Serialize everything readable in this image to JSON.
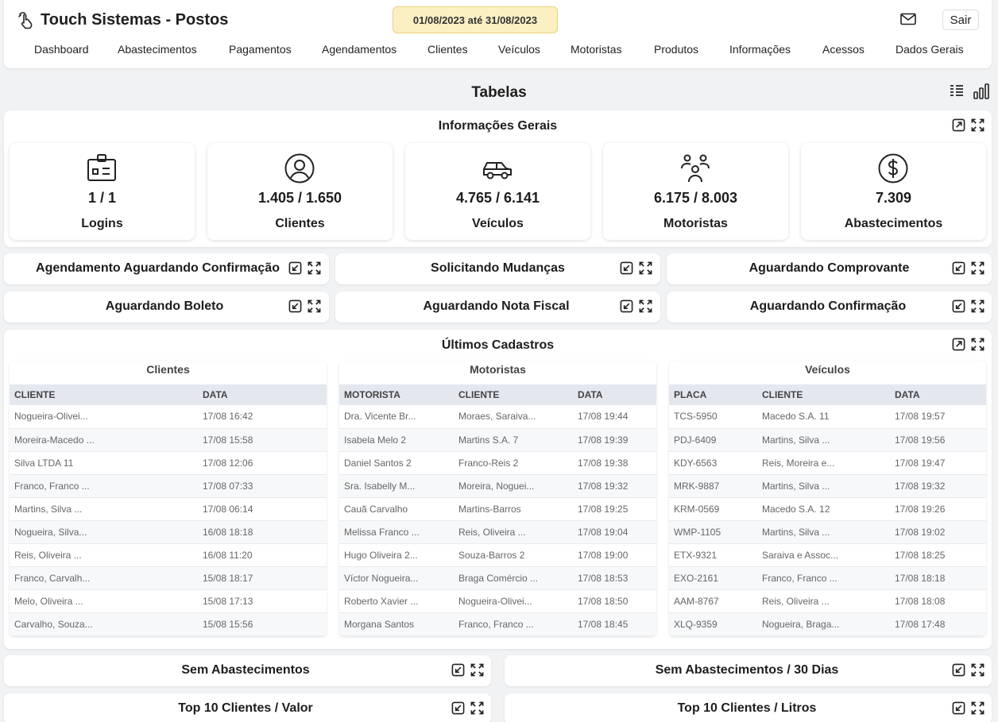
{
  "app": {
    "title": "Touch Sistemas - Postos"
  },
  "header": {
    "date_range": "01/08/2023 até 31/08/2023",
    "logout_label": "Sair",
    "nav": [
      "Dashboard",
      "Abastecimentos",
      "Pagamentos",
      "Agendamentos",
      "Clientes",
      "Veículos",
      "Motoristas",
      "Produtos",
      "Informações",
      "Acessos",
      "Dados Gerais"
    ]
  },
  "section": {
    "title": "Tabelas"
  },
  "info": {
    "title": "Informações Gerais",
    "stats": [
      {
        "icon": "id-card-icon",
        "value": "1 / 1",
        "label": "Logins"
      },
      {
        "icon": "user-circle-icon",
        "value": "1.405 / 1.650",
        "label": "Clientes"
      },
      {
        "icon": "car-icon",
        "value": "4.765 / 6.141",
        "label": "Veículos"
      },
      {
        "icon": "users-icon",
        "value": "6.175 / 8.003",
        "label": "Motoristas"
      },
      {
        "icon": "dollar-icon",
        "value": "7.309",
        "label": "Abastecimentos"
      }
    ]
  },
  "panels": {
    "agendamento": "Agendamento Aguardando Confirmação",
    "mudancas": "Solicitando Mudanças",
    "comprovante": "Aguardando Comprovante",
    "boleto": "Aguardando Boleto",
    "nota_fiscal": "Aguardando Nota Fiscal",
    "confirmacao": "Aguardando Confirmação",
    "sem_abast": "Sem Abastecimentos",
    "sem_abast_30": "Sem Abastecimentos / 30 Dias",
    "top_valor": "Top 10 Clientes / Valor",
    "top_litros": "Top 10 Clientes / Litros"
  },
  "ultimos": {
    "title": "Últimos Cadastros",
    "clientes": {
      "title": "Clientes",
      "headers": [
        "CLIENTE",
        "DATA"
      ],
      "rows": [
        [
          "Nogueira-Olivei...",
          "17/08 16:42"
        ],
        [
          "Moreira-Macedo ...",
          "17/08 15:58"
        ],
        [
          "Silva LTDA 11",
          "17/08 12:06"
        ],
        [
          "Franco, Franco ...",
          "17/08 07:33"
        ],
        [
          "Martins, Silva ...",
          "17/08 06:14"
        ],
        [
          "Nogueira, Silva...",
          "16/08 18:18"
        ],
        [
          "Reis, Oliveira ...",
          "16/08 11:20"
        ],
        [
          "Franco, Carvalh...",
          "15/08 18:17"
        ],
        [
          "Melo, Oliveira ...",
          "15/08 17:13"
        ],
        [
          "Carvalho, Souza...",
          "15/08 15:56"
        ]
      ]
    },
    "motoristas": {
      "title": "Motoristas",
      "headers": [
        "MOTORISTA",
        "CLIENTE",
        "DATA"
      ],
      "rows": [
        [
          "Dra. Vicente Br...",
          "Moraes, Saraiva...",
          "17/08 19:44"
        ],
        [
          "Isabela Melo 2",
          "Martins S.A. 7",
          "17/08 19:39"
        ],
        [
          "Daniel Santos 2",
          "Franco-Reis 2",
          "17/08 19:38"
        ],
        [
          "Sra. Isabelly M...",
          "Moreira, Noguei...",
          "17/08 19:32"
        ],
        [
          "Cauã Carvalho",
          "Martins-Barros",
          "17/08 19:25"
        ],
        [
          "Melissa Franco ...",
          "Reis, Oliveira ...",
          "17/08 19:04"
        ],
        [
          "Hugo Oliveira 2...",
          "Souza-Barros 2",
          "17/08 19:00"
        ],
        [
          "Víctor Nogueira...",
          "Braga Comércio ...",
          "17/08 18:53"
        ],
        [
          "Roberto Xavier ...",
          "Nogueira-Olivei...",
          "17/08 18:50"
        ],
        [
          "Morgana Santos",
          "Franco, Franco ...",
          "17/08 18:45"
        ]
      ]
    },
    "veiculos": {
      "title": "Veículos",
      "headers": [
        "PLACA",
        "CLIENTE",
        "DATA"
      ],
      "rows": [
        [
          "TCS-5950",
          "Macedo S.A. 11",
          "17/08 19:57"
        ],
        [
          "PDJ-6409",
          "Martins, Silva ...",
          "17/08 19:56"
        ],
        [
          "KDY-6563",
          "Reis, Moreira e...",
          "17/08 19:47"
        ],
        [
          "MRK-9887",
          "Martins, Silva ...",
          "17/08 19:32"
        ],
        [
          "KRM-0569",
          "Macedo S.A. 12",
          "17/08 19:26"
        ],
        [
          "WMP-1105",
          "Martins, Silva ...",
          "17/08 19:02"
        ],
        [
          "ETX-9321",
          "Saraiva e Assoc...",
          "17/08 18:25"
        ],
        [
          "EXO-2161",
          "Franco, Franco ...",
          "17/08 18:18"
        ],
        [
          "AAM-8767",
          "Reis, Oliveira ...",
          "17/08 18:08"
        ],
        [
          "XLQ-9359",
          "Nogueira, Braga...",
          "17/08 17:48"
        ]
      ]
    }
  }
}
